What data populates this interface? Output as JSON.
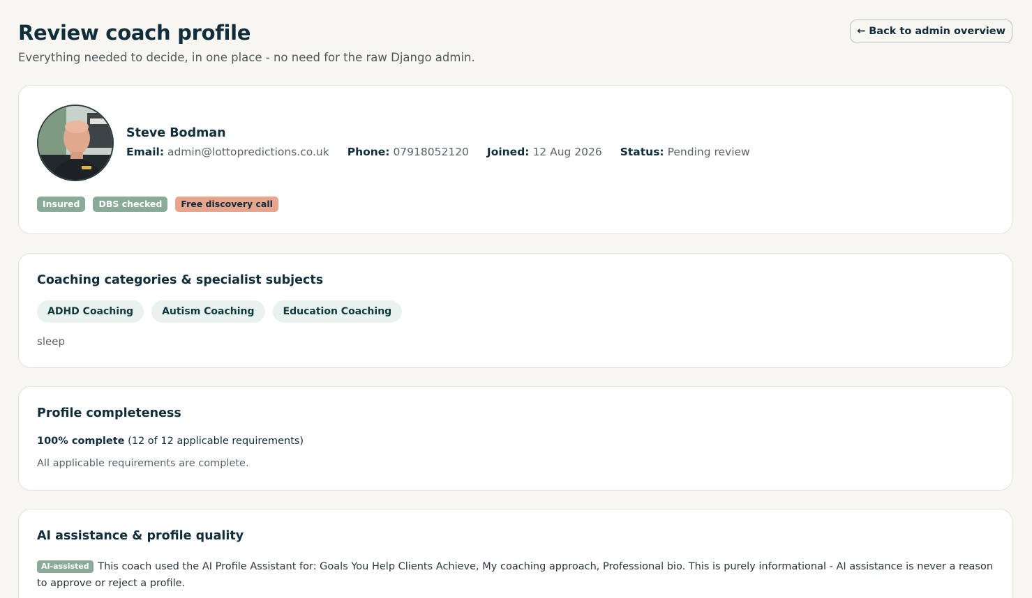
{
  "header": {
    "title": "Review coach profile",
    "subtitle": "Everything needed to decide, in one place - no need for the raw Django admin.",
    "back_label": "← Back to admin overview"
  },
  "profile": {
    "name": "Steve Bodman",
    "email_label": "Email:",
    "email": "admin@lottopredictions.co.uk",
    "phone_label": "Phone:",
    "phone": "07918052120",
    "joined_label": "Joined:",
    "joined": "12 Aug 2026",
    "status_label": "Status:",
    "status": "Pending review",
    "badges": [
      "Insured",
      "DBS checked",
      "Free discovery call"
    ]
  },
  "categories": {
    "title": "Coaching categories & specialist subjects",
    "items": [
      "ADHD Coaching",
      "Autism Coaching",
      "Education Coaching"
    ],
    "subjects": "sleep"
  },
  "completeness": {
    "title": "Profile completeness",
    "percent_label": "100% complete",
    "detail": "(12 of 12 applicable requirements)",
    "note": "All applicable requirements are complete."
  },
  "ai": {
    "title": "AI assistance & profile quality",
    "badge": "AI-assisted",
    "text": "This coach used the AI Profile Assistant for: Goals You Help Clients Achieve, My coaching approach, Professional bio. This is purely informational - AI assistance is never a reason to approve or reject a profile."
  },
  "colors": {
    "background": "#f8f6f1",
    "primary_text": "#0f2d3a",
    "badge_green": "#8aab98",
    "badge_salmon": "#e8a58d",
    "pill_bg": "#eaf2ef"
  }
}
